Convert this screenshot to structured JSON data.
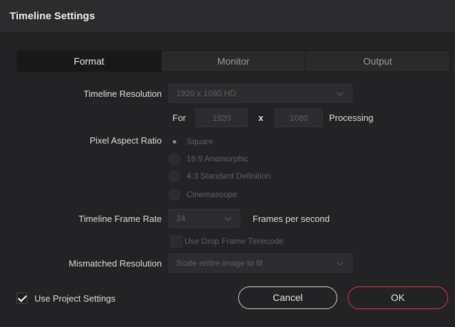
{
  "dialog": {
    "title": "Timeline Settings"
  },
  "tabs": [
    {
      "label": "Format",
      "active": true
    },
    {
      "label": "Monitor",
      "active": false
    },
    {
      "label": "Output",
      "active": false
    }
  ],
  "format": {
    "timeline_resolution": {
      "label": "Timeline Resolution",
      "value": "1920 x 1080 HD"
    },
    "custom_resolution": {
      "for_label": "For",
      "width": "1920",
      "x_label": "x",
      "height": "1080",
      "processing_label": "Processing"
    },
    "pixel_aspect_ratio": {
      "label": "Pixel Aspect Ratio",
      "options": [
        "Square",
        "16:9 Anamorphic",
        "4:3 Standard Definition",
        "Cinemascope"
      ],
      "selected": "Square"
    },
    "frame_rate": {
      "label": "Timeline Frame Rate",
      "value": "24",
      "suffix": "Frames per second"
    },
    "drop_frame": {
      "label": "Use Drop Frame Timecode",
      "checked": false
    },
    "mismatched_resolution": {
      "label": "Mismatched Resolution",
      "value": "Scale entire image to fit"
    }
  },
  "footer": {
    "use_project_settings": {
      "label": "Use Project Settings",
      "checked": true
    },
    "cancel_label": "Cancel",
    "ok_label": "OK"
  },
  "colors": {
    "accent_ok_border": "#d43b3b",
    "background": "#232325"
  }
}
